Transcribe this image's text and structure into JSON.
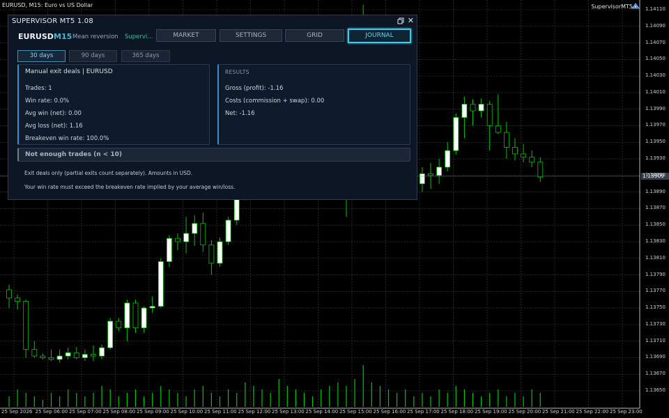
{
  "chart": {
    "caption": "EURUSD, M15:  Euro vs US Dollar",
    "ea_name": "SupervisorMT5",
    "current_price": "1.13909",
    "price_ticks": [
      "1.14110",
      "1.14090",
      "1.14070",
      "1.14050",
      "1.14030",
      "1.14010",
      "1.13990",
      "1.13970",
      "1.13950",
      "1.13930",
      "1.13910",
      "1.13890",
      "1.13870",
      "1.13850",
      "1.13830",
      "1.13810",
      "1.13790",
      "1.13770",
      "1.13750",
      "1.13730",
      "1.13710",
      "1.13690",
      "1.13670",
      "1.13650"
    ],
    "time_ticks": [
      "25 Sep 2026",
      "25 Sep 06:00",
      "25 Sep 07:00",
      "25 Sep 08:00",
      "25 Sep 09:00",
      "25 Sep 10:00",
      "25 Sep 11:00",
      "25 Sep 12:00",
      "25 Sep 13:00",
      "25 Sep 14:00",
      "25 Sep 15:00",
      "25 Sep 16:00",
      "25 Sep 17:00",
      "25 Sep 18:00",
      "25 Sep 19:00",
      "25 Sep 20:00",
      "25 Sep 21:00",
      "25 Sep 22:00",
      "25 Sep 23:00"
    ],
    "colors": {
      "background": "#000000",
      "grid": "#3a4a40",
      "up_body": "#ffffff",
      "down_body": "#000000",
      "wick": "#00c800",
      "volume": "#00c800",
      "price_tag": "#35404a"
    },
    "candles": [
      [
        1.13772,
        1.13778,
        1.1375,
        1.13762
      ],
      [
        1.13762,
        1.13766,
        1.13748,
        1.13758
      ],
      [
        1.13758,
        1.1376,
        1.1369,
        1.137
      ],
      [
        1.137,
        1.1371,
        1.1369,
        1.13692
      ],
      [
        1.13692,
        1.13695,
        1.13688,
        1.1369
      ],
      [
        1.1369,
        1.137,
        1.13686,
        1.13688
      ],
      [
        1.13688,
        1.137,
        1.13684,
        1.13692
      ],
      [
        1.13692,
        1.13702,
        1.13688,
        1.13696
      ],
      [
        1.13696,
        1.13703,
        1.13688,
        1.1369
      ],
      [
        1.1369,
        1.137,
        1.13686,
        1.13694
      ],
      [
        1.13694,
        1.13705,
        1.13686,
        1.13692
      ],
      [
        1.13692,
        1.13706,
        1.13688,
        1.13702
      ],
      [
        1.13702,
        1.13738,
        1.137,
        1.13734
      ],
      [
        1.13734,
        1.13738,
        1.13722,
        1.13726
      ],
      [
        1.13726,
        1.1376,
        1.1371,
        1.13756
      ],
      [
        1.13756,
        1.1376,
        1.1372,
        1.13726
      ],
      [
        1.13726,
        1.13752,
        1.1372,
        1.1375
      ],
      [
        1.1375,
        1.13764,
        1.13744,
        1.13752
      ],
      [
        1.13752,
        1.1381,
        1.1375,
        1.13806
      ],
      [
        1.13806,
        1.13838,
        1.138,
        1.13834
      ],
      [
        1.13834,
        1.1384,
        1.1382,
        1.1383
      ],
      [
        1.1383,
        1.1386,
        1.13816,
        1.1384
      ],
      [
        1.1384,
        1.13862,
        1.13825,
        1.13852
      ],
      [
        1.13852,
        1.13865,
        1.13818,
        1.13826
      ],
      [
        1.13826,
        1.13832,
        1.1379,
        1.13804
      ],
      [
        1.13804,
        1.13835,
        1.138,
        1.1383
      ],
      [
        1.1383,
        1.1386,
        1.13826,
        1.13856
      ],
      [
        1.13856,
        1.1389,
        1.1385,
        1.13884
      ],
      [
        1.13884,
        1.14,
        1.1388,
        1.1396
      ],
      [
        1.1396,
        1.1399,
        1.13935,
        1.13982
      ],
      [
        1.13982,
        1.1402,
        1.1396,
        1.1397
      ],
      [
        1.1397,
        1.14005,
        1.13955,
        1.13998
      ],
      [
        1.13998,
        1.1404,
        1.1399,
        1.1403
      ],
      [
        1.1403,
        1.14045,
        1.13955,
        1.1396
      ],
      [
        1.1396,
        1.13992,
        1.1395,
        1.13972
      ],
      [
        1.13972,
        1.1402,
        1.1396,
        1.13986
      ],
      [
        1.13986,
        1.13996,
        1.13975,
        1.1398
      ],
      [
        1.1398,
        1.1399,
        1.1396,
        1.13978
      ],
      [
        1.13978,
        1.1399,
        1.13915,
        1.13918
      ],
      [
        1.13918,
        1.13996,
        1.13905,
        1.1399
      ],
      [
        1.1399,
        1.14058,
        1.1386,
        1.13992
      ],
      [
        1.13992,
        1.14062,
        1.13985,
        1.14064
      ],
      [
        1.14064,
        1.14116,
        1.13985,
        1.1399
      ],
      [
        1.1399,
        1.14,
        1.1395,
        1.1398
      ],
      [
        1.1398,
        1.1399,
        1.1393,
        1.13944
      ],
      [
        1.13944,
        1.1396,
        1.1392,
        1.13926
      ],
      [
        1.13926,
        1.1394,
        1.1389,
        1.139
      ],
      [
        1.139,
        1.1392,
        1.1389,
        1.13895
      ],
      [
        1.13895,
        1.1391,
        1.13886,
        1.139
      ],
      [
        1.139,
        1.1392,
        1.1389,
        1.13912
      ],
      [
        1.13912,
        1.13925,
        1.13894,
        1.1391
      ],
      [
        1.1391,
        1.1393,
        1.139,
        1.1392
      ],
      [
        1.1392,
        1.1395,
        1.13915,
        1.1394
      ],
      [
        1.1394,
        1.13985,
        1.13935,
        1.1398
      ],
      [
        1.1398,
        1.14005,
        1.13955,
        1.13996
      ],
      [
        1.13996,
        1.14002,
        1.1397,
        1.13988
      ],
      [
        1.13988,
        1.14003,
        1.1398,
        1.13996
      ],
      [
        1.13996,
        1.14,
        1.1394,
        1.1397
      ],
      [
        1.1397,
        1.14008,
        1.1396,
        1.13962
      ],
      [
        1.13962,
        1.13975,
        1.1393,
        1.13944
      ],
      [
        1.13944,
        1.13955,
        1.13928,
        1.13936
      ],
      [
        1.13936,
        1.13948,
        1.13926,
        1.13932
      ],
      [
        1.13932,
        1.1394,
        1.1392,
        1.13926
      ],
      [
        1.13926,
        1.13932,
        1.13902,
        1.13908
      ]
    ],
    "volumes": [
      3,
      5,
      4,
      3,
      2,
      4,
      3,
      5,
      4,
      3,
      4,
      6,
      5,
      3,
      4,
      5,
      3,
      4,
      6,
      5,
      4,
      3,
      5,
      6,
      4,
      3,
      5,
      4,
      7,
      6,
      5,
      4,
      8,
      6,
      5,
      4,
      3,
      5,
      6,
      7,
      6,
      8,
      12,
      7,
      6,
      5,
      4,
      5,
      3,
      4,
      3,
      5,
      4,
      6,
      5,
      4,
      3,
      4,
      5,
      3,
      4,
      3,
      5,
      4
    ]
  },
  "panel": {
    "title": "SUPERVISOR MT5  1.08",
    "header": {
      "symbol": "EURUSD",
      "timeframe": "M15",
      "strategy": "Mean reversion",
      "supervisor": "Supervi..."
    },
    "tabs": [
      "MARKET",
      "SETTINGS",
      "GRID",
      "JOURNAL"
    ],
    "active_tab": "JOURNAL",
    "ranges": [
      "30 days",
      "90 days",
      "365 days"
    ],
    "active_range": "30 days",
    "stats": {
      "title": "Manual exit deals | EURUSD",
      "lines": [
        "Trades: 1",
        "Win rate: 0.0%",
        "Avg win (net): 0.00",
        "Avg loss (net): 1.16",
        "Breakeven win rate: 100.0%"
      ]
    },
    "results": {
      "title": "RESULTS",
      "lines": [
        "Gross (profit): -1.16",
        "Costs (commission + swap): 0.00",
        "Net: -1.16"
      ]
    },
    "banner": "Not enough trades (n < 10)",
    "footnotes": [
      "Exit deals only (partial exits count separately). Amounts in USD.",
      "Your win rate must exceed the breakeven rate implied by your average win/loss."
    ],
    "colors": {
      "accent": "#47c6e8",
      "card_border": "#3a8fd0",
      "supervisor": "#3dc0a0",
      "timeframe": "#48b7c9"
    }
  }
}
